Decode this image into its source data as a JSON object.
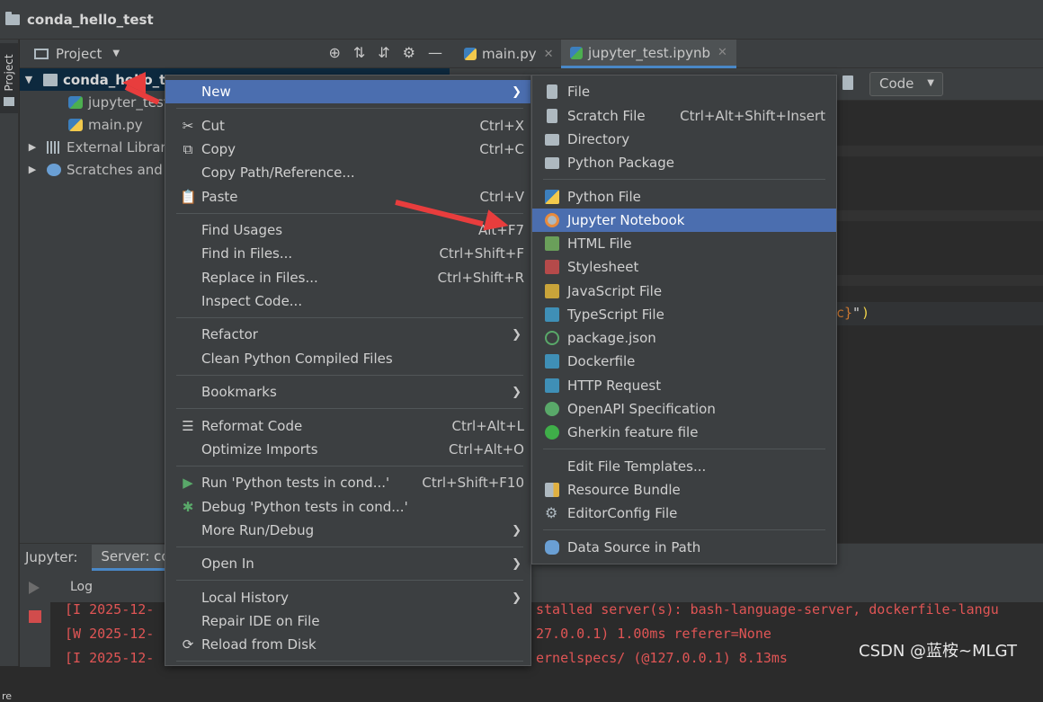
{
  "window": {
    "title": "conda_hello_test"
  },
  "left_strip": {
    "project_label": "Project",
    "bottom_label": "re"
  },
  "project_panel": {
    "header_label": "Project",
    "tree": [
      {
        "label": "conda_hello_test",
        "icon": "folder-icon"
      },
      {
        "label": "jupyter_test.ipynb",
        "icon": "jupyter-file-icon"
      },
      {
        "label": "main.py",
        "icon": "python-file-icon"
      },
      {
        "label": "External Libraries",
        "icon": "library-icon"
      },
      {
        "label": "Scratches and Consoles",
        "icon": "scratches-icon"
      }
    ]
  },
  "editor": {
    "tabs": [
      {
        "label": "main.py"
      },
      {
        "label": "jupyter_test.ipynb",
        "active": true
      }
    ],
    "cell_type": "Code",
    "code_fragment_brace": "c}",
    "code_fragment_quote": "\"",
    "code_fragment_paren": ")"
  },
  "bottom_panel": {
    "label": "Jupyter:",
    "server_tab": "Server: co",
    "log_tab": "Log",
    "log_lines": [
      {
        "prefix": "[I 2025-12-",
        "rest": "stalled server(s): bash-language-server, dockerfile-langu"
      },
      {
        "prefix": "[W 2025-12-",
        "rest": "27.0.0.1) 1.00ms referer=None"
      },
      {
        "prefix": "[I 2025-12-",
        "rest": "ernelspecs/ (@127.0.0.1) 8.13ms"
      }
    ]
  },
  "context_menu": {
    "items": [
      {
        "label": "New",
        "submenu": true,
        "highlighted": true
      },
      {
        "label": "Cut",
        "shortcut": "Ctrl+X",
        "icon": "✂"
      },
      {
        "label": "Copy",
        "shortcut": "Ctrl+C",
        "icon": "⧉"
      },
      {
        "label": "Copy Path/Reference..."
      },
      {
        "label": "Paste",
        "shortcut": "Ctrl+V",
        "icon": "📋"
      },
      {
        "label": "Find Usages",
        "shortcut": "Alt+F7"
      },
      {
        "label": "Find in Files...",
        "shortcut": "Ctrl+Shift+F"
      },
      {
        "label": "Replace in Files...",
        "shortcut": "Ctrl+Shift+R"
      },
      {
        "label": "Inspect Code..."
      },
      {
        "label": "Refactor",
        "submenu": true
      },
      {
        "label": "Clean Python Compiled Files"
      },
      {
        "label": "Bookmarks",
        "submenu": true
      },
      {
        "label": "Reformat Code",
        "shortcut": "Ctrl+Alt+L",
        "icon": "☰"
      },
      {
        "label": "Optimize Imports",
        "shortcut": "Ctrl+Alt+O"
      },
      {
        "label": "Run 'Python tests in cond...'",
        "shortcut": "Ctrl+Shift+F10",
        "icon": "▶"
      },
      {
        "label": "Debug 'Python tests in cond...'",
        "icon": "✱"
      },
      {
        "label": "More Run/Debug",
        "submenu": true
      },
      {
        "label": "Open In",
        "submenu": true
      },
      {
        "label": "Local History",
        "submenu": true
      },
      {
        "label": "Repair IDE on File"
      },
      {
        "label": "Reload from Disk",
        "icon": "⟳"
      }
    ]
  },
  "new_submenu": {
    "items": [
      {
        "label": "File",
        "icon": "file-icon"
      },
      {
        "label": "Scratch File",
        "shortcut": "Ctrl+Alt+Shift+Insert",
        "icon": "scratch-file-icon"
      },
      {
        "label": "Directory",
        "icon": "directory-icon"
      },
      {
        "label": "Python Package",
        "icon": "python-package-icon"
      },
      {
        "label": "Python File",
        "icon": "python-file-icon"
      },
      {
        "label": "Jupyter Notebook",
        "icon": "jupyter-icon",
        "highlighted": true
      },
      {
        "label": "HTML File",
        "icon": "html-icon"
      },
      {
        "label": "Stylesheet",
        "icon": "css-icon"
      },
      {
        "label": "JavaScript File",
        "icon": "js-icon"
      },
      {
        "label": "TypeScript File",
        "icon": "ts-icon"
      },
      {
        "label": "package.json",
        "icon": "nodejs-icon"
      },
      {
        "label": "Dockerfile",
        "icon": "docker-icon"
      },
      {
        "label": "HTTP Request",
        "icon": "api-icon"
      },
      {
        "label": "OpenAPI Specification",
        "icon": "openapi-icon"
      },
      {
        "label": "Gherkin feature file",
        "icon": "gherkin-icon"
      },
      {
        "label": "Edit File Templates..."
      },
      {
        "label": "Resource Bundle",
        "icon": "resource-bundle-icon"
      },
      {
        "label": "EditorConfig File",
        "icon": "gear-icon"
      },
      {
        "label": "Data Source in Path",
        "icon": "database-icon"
      }
    ]
  },
  "watermark": "CSDN @蓝桉~MLGT",
  "colors": {
    "highlight": "#4b6eaf",
    "annotation_arrow": "#e83d3d",
    "log_text": "#e05555"
  }
}
